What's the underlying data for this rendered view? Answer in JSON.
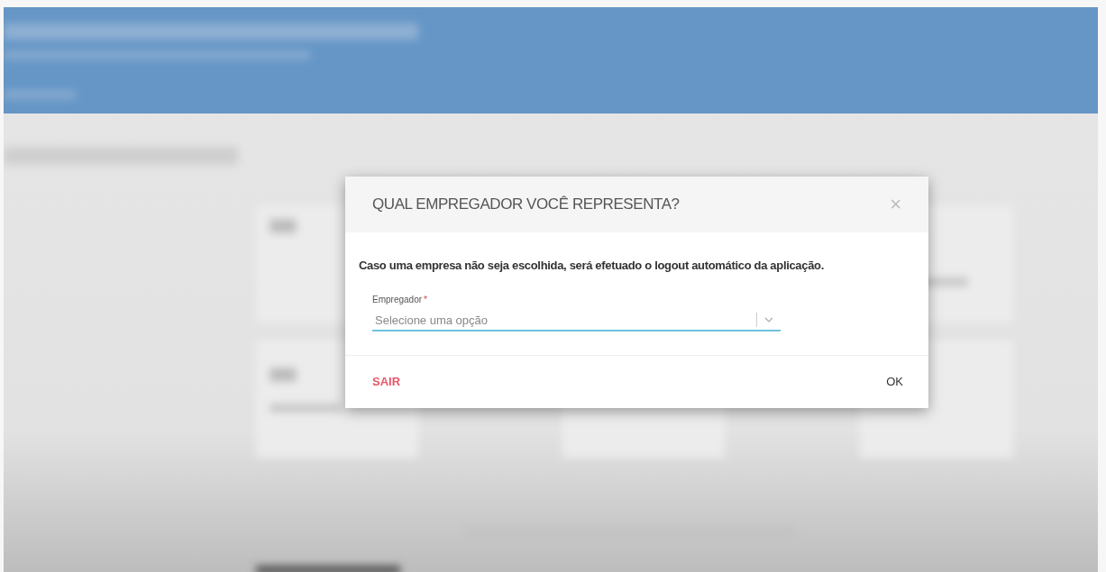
{
  "dialog": {
    "title": "QUAL EMPREGADOR VOCÊ REPRESENTA?",
    "close": "×",
    "message": "Caso uma empresa não seja escolhida, será efetuado o logout automático da aplicação.",
    "field": {
      "label": "Empregador",
      "required_mark": "*",
      "placeholder": "Selecione uma opção"
    },
    "buttons": [
      {
        "kind": "cancel",
        "label": "SAIR"
      },
      {
        "kind": "confirm",
        "label": "OK"
      }
    ]
  }
}
